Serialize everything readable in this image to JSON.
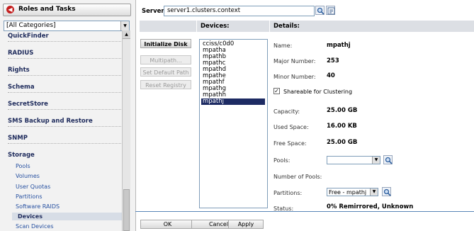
{
  "sidebar": {
    "title": "Roles and Tasks",
    "category_select": "[All Categories]",
    "sections": [
      {
        "label": "QuickFinder"
      },
      {
        "label": "RADIUS"
      },
      {
        "label": "Rights"
      },
      {
        "label": "Schema"
      },
      {
        "label": "SecretStore"
      },
      {
        "label": "SMS Backup and Restore"
      },
      {
        "label": "SNMP"
      },
      {
        "label": "Storage"
      }
    ],
    "storage_items": [
      "Pools",
      "Volumes",
      "User Quotas",
      "Partitions",
      "Software RAIDS",
      "Devices",
      "Scan Devices"
    ]
  },
  "server": {
    "label": "Server:",
    "value": "server1.clusters.context"
  },
  "columns": {
    "devices": "Devices:",
    "details": "Details:"
  },
  "actions": {
    "initialize": "Initialize Disk",
    "multipath": "Multipath...",
    "set_default": "Set Default Path",
    "reset_registry": "Reset Registry"
  },
  "devices": [
    "cciss/c0d0",
    "mpatha",
    "mpathb",
    "mpathc",
    "mpathd",
    "mpathe",
    "mpathf",
    "mpathg",
    "mpathh",
    "mpathj"
  ],
  "selected_device": "mpathj",
  "details": {
    "name_label": "Name:",
    "name": "mpathj",
    "major_label": "Major Number:",
    "major": "253",
    "minor_label": "Minor Number:",
    "minor": "40",
    "shareable_label": "Shareable for Clustering",
    "capacity_label": "Capacity:",
    "capacity": "25.00 GB",
    "used_label": "Used Space:",
    "used": "16.00 KB",
    "free_label": "Free Space:",
    "free": "25.00 GB",
    "pools_label": "Pools:",
    "pools_value": "",
    "num_pools_label": "Number of Pools:",
    "partitions_label": "Partitions:",
    "partitions_value": "Free - mpathj",
    "status_label": "Status:",
    "status": "0% Remirrored, Unknown"
  },
  "footer": {
    "ok": "OK",
    "cancel": "Cancel",
    "apply": "Apply"
  },
  "colors": {
    "selection": "#1d2b63",
    "header_bg": "#dcdfe4",
    "link": "#2650a0",
    "footer_line": "#5a86b8"
  }
}
